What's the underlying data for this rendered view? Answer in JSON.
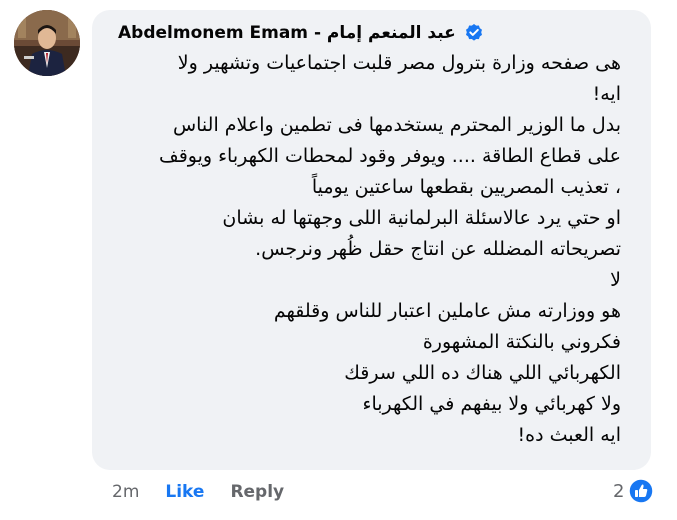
{
  "comment": {
    "author_name": "Abdelmonem Emam - عبد المنعم إمام",
    "verified": true,
    "lines": [
      "هى صفحه وزارة بترول مصر قلبت اجتماعيات وتشهير ولا",
      "ايه!",
      "بدل ما الوزير المحترم يستخدمها فى تطمين واعلام الناس",
      "على قطاع الطاقة .... ويوفر وقود لمحطات الكهرباء ويوقف",
      "، تعذيب المصريين بقطعها ساعتين يومياً",
      "او حتي يرد عالاسئلة البرلمانية اللى وجهتها له بشان",
      "تصريحاته  المضلله عن انتاج حقل ظُهر ونرجس.",
      "لا",
      "هو ووزارته مش عاملين اعتبار للناس وقلقهم",
      "فكروني بالنكتة المشهورة",
      "الكهربائي اللي هناك ده اللي سرقك",
      "ولا كهربائي ولا بيفهم في الكهرباء",
      "ايه العبث ده!"
    ]
  },
  "actions": {
    "timestamp": "2m",
    "like_label": "Like",
    "reply_label": "Reply"
  },
  "reactions": {
    "count": "2",
    "icon": "like-icon"
  },
  "colors": {
    "bubble_bg": "#f0f2f5",
    "accent": "#1877f2",
    "muted": "#65676b",
    "text": "#050505"
  }
}
